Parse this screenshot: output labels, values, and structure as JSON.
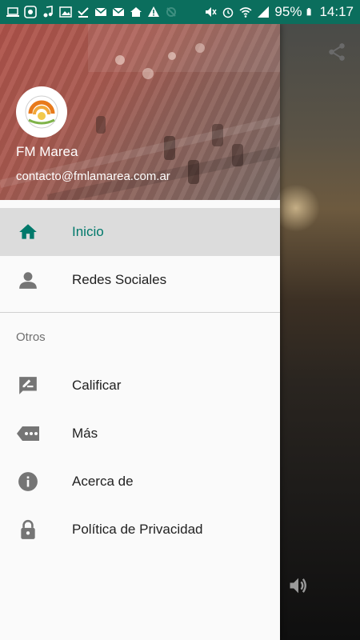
{
  "status_bar": {
    "battery": "95%",
    "time": "14:17"
  },
  "drawer": {
    "app_name": "FM Marea",
    "email": "contacto@fmlamarea.com.ar",
    "items": [
      {
        "label": "Inicio",
        "icon": "home-icon",
        "active": true
      },
      {
        "label": "Redes Sociales",
        "icon": "person-icon",
        "active": false
      }
    ],
    "section_title": "Otros",
    "other_items": [
      {
        "label": "Calificar",
        "icon": "rate-review-icon"
      },
      {
        "label": "Más",
        "icon": "more-tag-icon"
      },
      {
        "label": "Acerca de",
        "icon": "info-icon"
      },
      {
        "label": "Política de Privacidad",
        "icon": "lock-icon"
      }
    ]
  },
  "colors": {
    "status_bar": "#0b6e5d",
    "accent": "#00796b",
    "drawer_bg": "#fafafa",
    "active_item_bg": "#dcdcdc"
  }
}
